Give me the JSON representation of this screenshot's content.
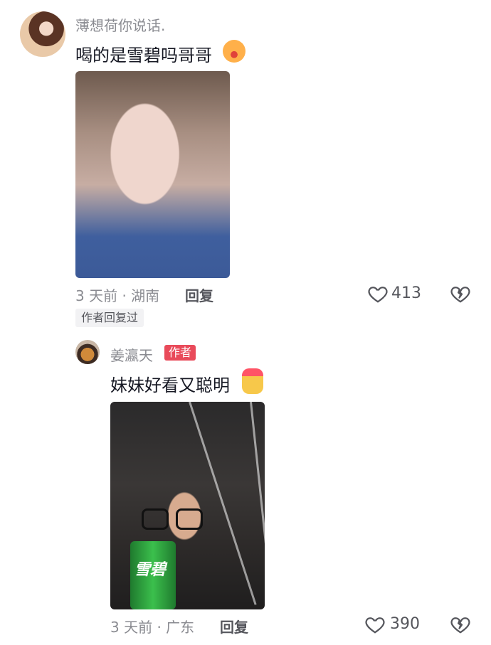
{
  "comment": {
    "username": "薄想荷你说话.",
    "text": "喝的是雪碧吗哥哥",
    "emoji_icon": "kiss-face-emoji",
    "time_location": "3 天前 · 湖南",
    "reply_label": "回复",
    "like_count": "413",
    "author_replied_badge": "作者回复过"
  },
  "reply": {
    "username": "姜瀛天",
    "author_badge": "作者",
    "text": "妹妹好看又聪明",
    "emoji_icon": "finger-heart-emoji",
    "time_location": "3 天前 · 广东",
    "reply_label": "回复",
    "like_count": "390",
    "can_brand_text": "雪碧"
  },
  "colors": {
    "meta_text": "#8a8b91",
    "author_badge_bg": "#e94a5a",
    "can_green": "#2f9e3f"
  }
}
